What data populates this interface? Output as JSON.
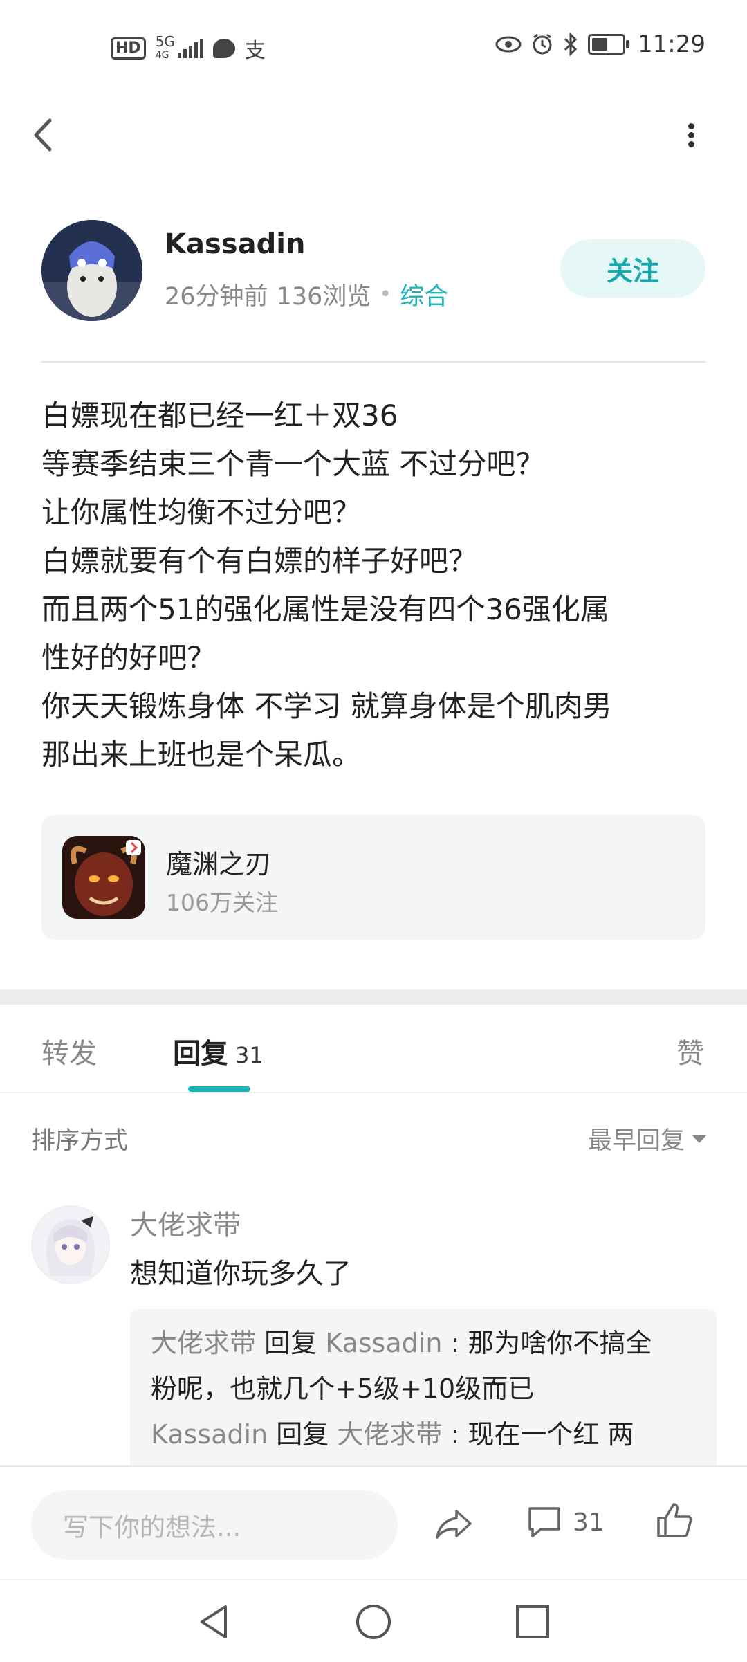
{
  "status_bar": {
    "hd": "HD",
    "network": "5G",
    "network_sub": "4G",
    "alipay_glyph": "支",
    "time": "11:29",
    "battery_level": 0.45,
    "icons": [
      "hd-icon",
      "signal-icon",
      "message-icon",
      "alipay-icon",
      "eye-icon",
      "alarm-icon",
      "bluetooth-icon",
      "battery-icon"
    ]
  },
  "nav": {
    "back_icon": "chevron-left-icon",
    "more_icon": "more-vertical-icon"
  },
  "author": {
    "name": "Kassadin",
    "time_ago": "26分钟前",
    "views": "136浏览",
    "separator": "•",
    "category": "综合",
    "follow_label": "关注"
  },
  "post": {
    "lines": [
      "白嫖现在都已经一红＋双36",
      "等赛季结束三个青一个大蓝 不过分吧？",
      "让你属性均衡不过分吧？",
      "白嫖就要有个有白嫖的样子好吧？",
      "而且两个51的强化属性是没有四个36强化属",
      "性好的好吧？",
      "你天天锻炼身体  不学习 就算身体是个肌肉男",
      "那出来上班也是个呆瓜。"
    ]
  },
  "game": {
    "name": "魔渊之刃",
    "followers": "106万关注"
  },
  "tabs": {
    "forward": "转发",
    "replies": "回复",
    "replies_count": "31",
    "likes": "赞"
  },
  "sort": {
    "label": "排序方式",
    "value": "最早回复"
  },
  "comment": {
    "author": "大佬求带",
    "text": "想知道你玩多久了",
    "replies": [
      {
        "from": "大佬求带",
        "verb": "回复",
        "to": "Kassadin",
        "colon": " : ",
        "text": "那为啥你不搞全"
      },
      {
        "continuation": "粉呢，也就几个+5级+10级而已"
      },
      {
        "from": "Kassadin",
        "verb": "回复",
        "to": "大佬求带",
        "colon": " : ",
        "text": "现在一个红  两"
      }
    ]
  },
  "bottom_bar": {
    "input_placeholder": "写下你的想法...",
    "comment_count": "31",
    "icons": [
      "share-icon",
      "comment-icon",
      "like-icon"
    ]
  },
  "colors": {
    "accent": "#1cb3b8",
    "follow_bg": "#e6f7f7",
    "card_bg": "#f4f5f6"
  }
}
